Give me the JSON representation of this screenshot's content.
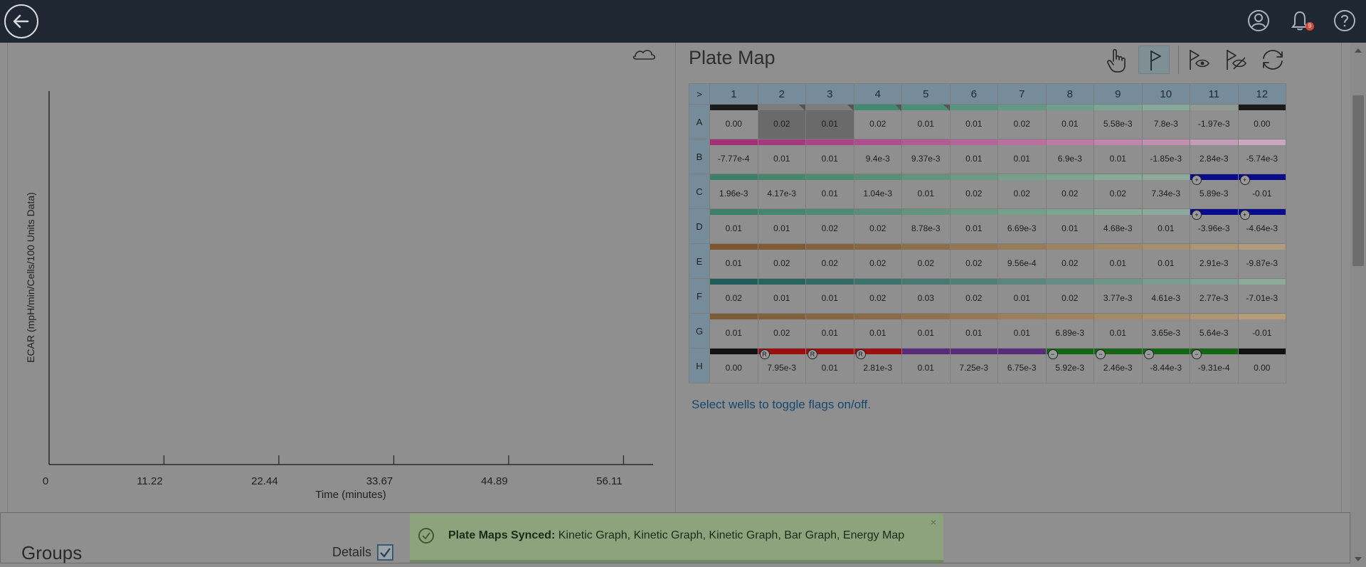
{
  "topbar": {
    "back_icon": "arrow-left-icon",
    "icons": [
      "user-icon",
      "bell-icon",
      "help-icon"
    ],
    "notification_count": "9"
  },
  "chart_data": {
    "type": "line",
    "ylabel": "ECAR (mpH/min/Cells/100 Units Data)",
    "xlabel": "Time (minutes)",
    "x_ticks": [
      "0",
      "11.22",
      "22.44",
      "33.67",
      "44.89",
      "56.11"
    ],
    "xlim": [
      0,
      59
    ],
    "series": []
  },
  "plate": {
    "title": "Plate Map",
    "corner": ">",
    "columns": [
      "1",
      "2",
      "3",
      "4",
      "5",
      "6",
      "7",
      "8",
      "9",
      "10",
      "11",
      "12"
    ],
    "rows": [
      {
        "label": "A",
        "bar": "#000000",
        "cells": [
          "0.00",
          "0.02",
          "0.01",
          "0.02",
          "0.01",
          "0.01",
          "0.02",
          "0.01",
          "5.58e-3",
          "7.8e-3",
          "-1.97e-3",
          "0.00"
        ],
        "bars": [
          "#1a1a1a",
          "#7d7d7d",
          "#7d7d7d",
          "#3f8a70",
          "#4a8f78",
          "#56947f",
          "#629a86",
          "#6e9f8d",
          "#7aa594",
          "#86aa9b",
          "#8f9a93",
          "#1a1a1a"
        ],
        "selected": [
          false,
          true,
          true,
          false,
          false,
          false,
          false,
          false,
          false,
          false,
          false,
          false
        ],
        "notched": [
          false,
          true,
          true,
          true,
          true,
          false,
          false,
          false,
          false,
          false,
          false,
          false
        ]
      },
      {
        "label": "B",
        "cells": [
          "-7.77e-4",
          "0.01",
          "0.01",
          "9.4e-3",
          "9.37e-3",
          "0.01",
          "0.01",
          "6.9e-3",
          "0.01",
          "-1.85e-3",
          "2.84e-3",
          "-5.74e-3"
        ],
        "bars": [
          "#a3307a",
          "#a33a80",
          "#a84487",
          "#ad4f8e",
          "#b15a94",
          "#b5659a",
          "#b970a1",
          "#bc7ba7",
          "#bf86ad",
          "#c291b2",
          "#c59cb8",
          "#c9a7bd"
        ]
      },
      {
        "label": "C",
        "cells": [
          "1.96e-3",
          "4.17e-3",
          "0.01",
          "1.04e-3",
          "0.01",
          "0.02",
          "0.02",
          "0.02",
          "0.02",
          "7.34e-3",
          "5.89e-3",
          "-0.01"
        ],
        "bars": [
          "#3d7f68",
          "#46856e",
          "#4f8a74",
          "#598f7a",
          "#629580",
          "#6b9a86",
          "#75a08c",
          "#7ea592",
          "#87ab98",
          "#8ea89d",
          "#0a0a8c",
          "#0a0a8c"
        ],
        "badges": [
          null,
          null,
          null,
          null,
          null,
          null,
          null,
          null,
          null,
          null,
          "+",
          "+"
        ]
      },
      {
        "label": "D",
        "cells": [
          "0.01",
          "0.01",
          "0.02",
          "0.02",
          "8.78e-3",
          "0.01",
          "6.69e-3",
          "0.01",
          "4.68e-3",
          "0.01",
          "-3.96e-3",
          "-4.64e-3"
        ],
        "bars": [
          "#3d7f68",
          "#46856e",
          "#4f8a74",
          "#598f7a",
          "#629580",
          "#6b9a86",
          "#75a08c",
          "#7ea592",
          "#87ab98",
          "#8ea89d",
          "#0a0a8c",
          "#0a0a8c"
        ],
        "badges": [
          null,
          null,
          null,
          null,
          null,
          null,
          null,
          null,
          null,
          null,
          "+",
          "+"
        ]
      },
      {
        "label": "E",
        "cells": [
          "0.01",
          "0.02",
          "0.02",
          "0.02",
          "0.02",
          "0.02",
          "9.56e-4",
          "0.02",
          "0.01",
          "0.01",
          "2.91e-3",
          "-9.87e-3"
        ],
        "bars": [
          "#7a5530",
          "#7f5b36",
          "#84623d",
          "#896844",
          "#8e6f4b",
          "#937552",
          "#987c59",
          "#9c8260",
          "#a18967",
          "#a68f6e",
          "#ab9675",
          "#b09c7c"
        ]
      },
      {
        "label": "F",
        "cells": [
          "0.02",
          "0.01",
          "0.01",
          "0.02",
          "0.03",
          "0.02",
          "0.01",
          "0.02",
          "3.77e-3",
          "4.61e-3",
          "2.77e-3",
          "-7.01e-3"
        ],
        "bars": [
          "#1f5c5a",
          "#296360",
          "#336a66",
          "#3d716c",
          "#477872",
          "#517f78",
          "#5b867e",
          "#658d84",
          "#6f948a",
          "#799b90",
          "#83a296",
          "#8da99c"
        ]
      },
      {
        "label": "G",
        "cells": [
          "0.01",
          "0.02",
          "0.01",
          "0.01",
          "0.01",
          "0.01",
          "0.01",
          "6.89e-3",
          "0.01",
          "3.65e-3",
          "5.64e-3",
          "-0.01"
        ],
        "bars": [
          "#7d5a36",
          "#82603c",
          "#876642",
          "#8c6c48",
          "#91724e",
          "#967854",
          "#9b7e5a",
          "#a08460",
          "#a58a66",
          "#aa906c",
          "#af9672",
          "#b49c78"
        ]
      },
      {
        "label": "H",
        "cells": [
          "0.00",
          "7.95e-3",
          "0.01",
          "2.81e-3",
          "0.01",
          "7.25e-3",
          "6.75e-3",
          "5.92e-3",
          "2.46e-3",
          "-8.44e-3",
          "-9.31e-4",
          "0.00"
        ],
        "bars": [
          "#111111",
          "#9a1010",
          "#9a1010",
          "#9a1010",
          "#5a2a7a",
          "#5a2a7a",
          "#5a2a7a",
          "#146614",
          "#146614",
          "#146614",
          "#146614",
          "#111111"
        ],
        "badges": [
          null,
          "R",
          "R",
          "R",
          null,
          null,
          null,
          "−",
          "−",
          "−",
          "−",
          null
        ]
      }
    ],
    "hint": "Select wells to toggle flags on/off."
  },
  "toolbar": {
    "tools": [
      "hand-pointer-icon",
      "flag-icon",
      "flag-show-icon",
      "flag-hide-icon",
      "refresh-icon"
    ]
  },
  "groups": {
    "title": "Groups",
    "details_label": "Details"
  },
  "toast": {
    "title": "Plate Maps Synced:",
    "message": "Kinetic Graph, Kinetic Graph, Kinetic Graph, Bar Graph, Energy Map",
    "close": "×"
  }
}
